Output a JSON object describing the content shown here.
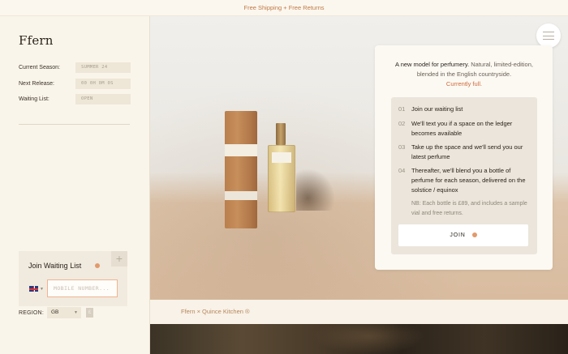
{
  "topbar": {
    "text": "Free Shipping + Free Returns"
  },
  "brand": {
    "logo": "Ffern"
  },
  "info": {
    "current_season_label": "Current Season:",
    "current_season_value": "SUMMER 24",
    "next_release_label": "Next Release:",
    "next_release_value": "00 0H 0M 0S",
    "waiting_list_label": "Waiting List:",
    "waiting_list_value": "OPEN"
  },
  "join_box": {
    "title": "Join Waiting List",
    "plus_label": "+",
    "mobile_placeholder": "MOBILE NUMBER...",
    "country_caret": "▼"
  },
  "region": {
    "label": "REGION:",
    "selected": "GB",
    "caret": "▼",
    "action": "£"
  },
  "card": {
    "intro_strong": "A new model for perfumery.",
    "intro_rest": " Natural, limited-edition, blended in the English countryside.",
    "status": "Currently full.",
    "steps": [
      {
        "num": "01",
        "text": "Join our waiting list"
      },
      {
        "num": "02",
        "text": "We'll text you if a space on the ledger becomes available"
      },
      {
        "num": "03",
        "text": "Take up the space and we'll send you our latest perfume"
      },
      {
        "num": "04",
        "text": "Thereafter, we'll blend you a bottle of perfume for each season, delivered on the solstice / equinox"
      }
    ],
    "nb": "NB: Each bottle is £89, and includes a sample vial and free returns.",
    "join_label": "JOIN"
  },
  "collab": {
    "text": "Ffern × Quince Kitchen ®"
  },
  "colors": {
    "accent": "#e29a6c",
    "status": "#cf6a3a",
    "background": "#fbf7ef"
  },
  "icons": {
    "menu": "hamburger-menu-icon",
    "plus": "plus-icon",
    "flag": "uk-flag-icon",
    "dot": "status-dot-icon"
  }
}
